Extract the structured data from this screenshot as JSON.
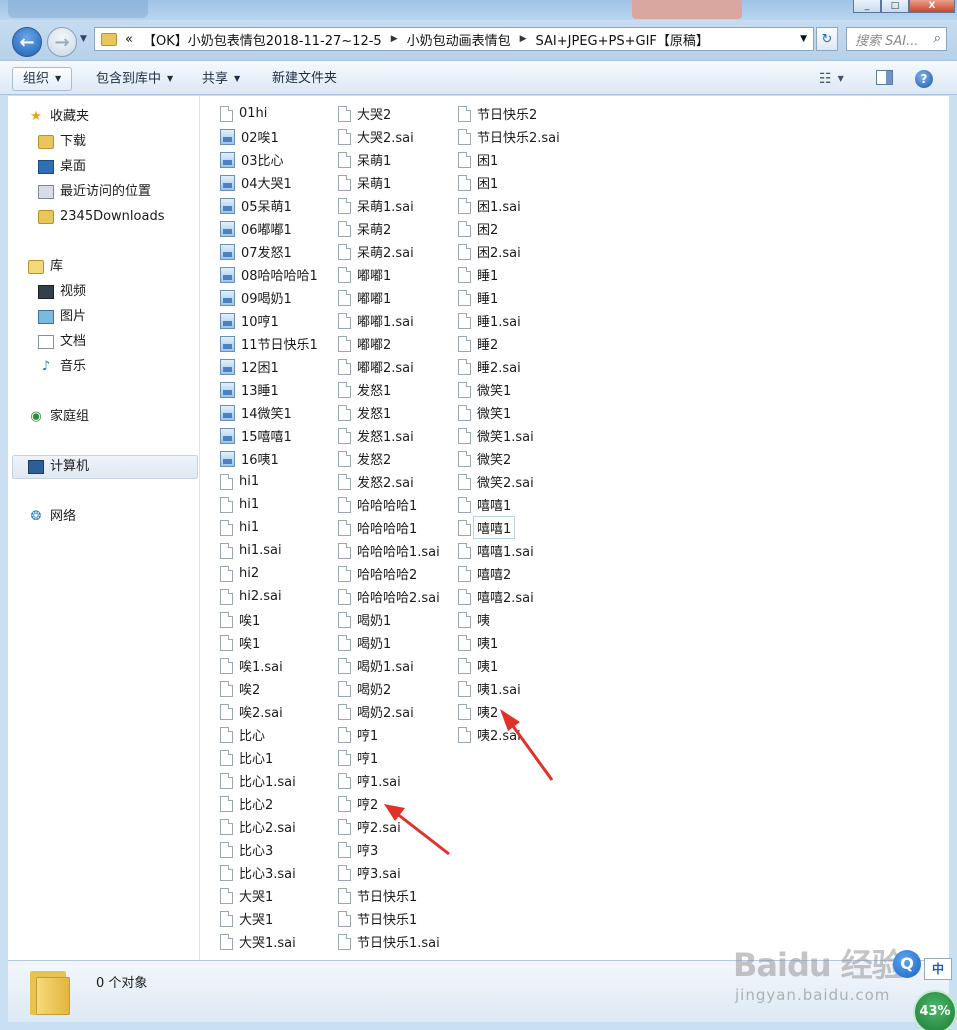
{
  "window": {
    "close_label": "X",
    "min_label": "_",
    "max_label": "□"
  },
  "address": {
    "overflow": "«",
    "segments": [
      "【OK】小奶包表情包2018-11-27~12-5",
      "小奶包动画表情包",
      "SAI+JPEG+PS+GIF【原稿】"
    ],
    "search_placeholder": "搜索 SAI..."
  },
  "toolbar": {
    "organize": "组织",
    "include_in_library": "包含到库中",
    "share": "共享",
    "new_folder": "新建文件夹"
  },
  "nav": {
    "favorites": "收藏夹",
    "downloads": "下载",
    "desktop": "桌面",
    "recent": "最近访问的位置",
    "downloads2345": "2345Downloads",
    "libraries": "库",
    "videos": "视频",
    "pictures": "图片",
    "documents": "文档",
    "music": "音乐",
    "homegroup": "家庭组",
    "computer": "计算机",
    "network": "网络"
  },
  "files": {
    "col1": [
      {
        "name": "01hi",
        "type": "file"
      },
      {
        "name": "02唉1",
        "type": "image"
      },
      {
        "name": "03比心",
        "type": "image"
      },
      {
        "name": "04大哭1",
        "type": "image"
      },
      {
        "name": "05呆萌1",
        "type": "image"
      },
      {
        "name": "06嘟嘟1",
        "type": "image"
      },
      {
        "name": "07发怒1",
        "type": "image"
      },
      {
        "name": "08哈哈哈哈1",
        "type": "image"
      },
      {
        "name": "09喝奶1",
        "type": "image"
      },
      {
        "name": "10哼1",
        "type": "image"
      },
      {
        "name": "11节日快乐1",
        "type": "image"
      },
      {
        "name": "12困1",
        "type": "image"
      },
      {
        "name": "13睡1",
        "type": "image"
      },
      {
        "name": "14微笑1",
        "type": "image"
      },
      {
        "name": "15嘻嘻1",
        "type": "image"
      },
      {
        "name": "16咦1",
        "type": "image"
      },
      {
        "name": "hi1",
        "type": "file"
      },
      {
        "name": "hi1",
        "type": "file"
      },
      {
        "name": "hi1",
        "type": "file"
      },
      {
        "name": "hi1.sai",
        "type": "file"
      },
      {
        "name": "hi2",
        "type": "file"
      },
      {
        "name": "hi2.sai",
        "type": "file"
      },
      {
        "name": "唉1",
        "type": "file"
      },
      {
        "name": "唉1",
        "type": "file"
      },
      {
        "name": "唉1.sai",
        "type": "file"
      },
      {
        "name": "唉2",
        "type": "file"
      },
      {
        "name": "唉2.sai",
        "type": "file"
      },
      {
        "name": "比心",
        "type": "file"
      },
      {
        "name": "比心1",
        "type": "file"
      },
      {
        "name": "比心1.sai",
        "type": "file"
      },
      {
        "name": "比心2",
        "type": "file"
      },
      {
        "name": "比心2.sai",
        "type": "file"
      },
      {
        "name": "比心3",
        "type": "file"
      },
      {
        "name": "比心3.sai",
        "type": "file"
      },
      {
        "name": "大哭1",
        "type": "file"
      },
      {
        "name": "大哭1",
        "type": "file"
      },
      {
        "name": "大哭1.sai",
        "type": "file"
      }
    ],
    "col2": [
      {
        "name": "大哭2",
        "type": "file"
      },
      {
        "name": "大哭2.sai",
        "type": "file"
      },
      {
        "name": "呆萌1",
        "type": "file"
      },
      {
        "name": "呆萌1",
        "type": "file"
      },
      {
        "name": "呆萌1.sai",
        "type": "file"
      },
      {
        "name": "呆萌2",
        "type": "file"
      },
      {
        "name": "呆萌2.sai",
        "type": "file"
      },
      {
        "name": "嘟嘟1",
        "type": "file"
      },
      {
        "name": "嘟嘟1",
        "type": "file"
      },
      {
        "name": "嘟嘟1.sai",
        "type": "file"
      },
      {
        "name": "嘟嘟2",
        "type": "file"
      },
      {
        "name": "嘟嘟2.sai",
        "type": "file"
      },
      {
        "name": "发怒1",
        "type": "file"
      },
      {
        "name": "发怒1",
        "type": "file"
      },
      {
        "name": "发怒1.sai",
        "type": "file"
      },
      {
        "name": "发怒2",
        "type": "file"
      },
      {
        "name": "发怒2.sai",
        "type": "file"
      },
      {
        "name": "哈哈哈哈1",
        "type": "file"
      },
      {
        "name": "哈哈哈哈1",
        "type": "file"
      },
      {
        "name": "哈哈哈哈1.sai",
        "type": "file"
      },
      {
        "name": "哈哈哈哈2",
        "type": "file"
      },
      {
        "name": "哈哈哈哈2.sai",
        "type": "file"
      },
      {
        "name": "喝奶1",
        "type": "file"
      },
      {
        "name": "喝奶1",
        "type": "file"
      },
      {
        "name": "喝奶1.sai",
        "type": "file"
      },
      {
        "name": "喝奶2",
        "type": "file"
      },
      {
        "name": "喝奶2.sai",
        "type": "file"
      },
      {
        "name": "哼1",
        "type": "file"
      },
      {
        "name": "哼1",
        "type": "file"
      },
      {
        "name": "哼1.sai",
        "type": "file"
      },
      {
        "name": "哼2",
        "type": "file"
      },
      {
        "name": "哼2.sai",
        "type": "file"
      },
      {
        "name": "哼3",
        "type": "file"
      },
      {
        "name": "哼3.sai",
        "type": "file"
      },
      {
        "name": "节日快乐1",
        "type": "file"
      },
      {
        "name": "节日快乐1",
        "type": "file"
      },
      {
        "name": "节日快乐1.sai",
        "type": "file"
      }
    ],
    "col3": [
      {
        "name": "节日快乐2",
        "type": "file"
      },
      {
        "name": "节日快乐2.sai",
        "type": "file"
      },
      {
        "name": "困1",
        "type": "file"
      },
      {
        "name": "困1",
        "type": "file"
      },
      {
        "name": "困1.sai",
        "type": "file"
      },
      {
        "name": "困2",
        "type": "file"
      },
      {
        "name": "困2.sai",
        "type": "file"
      },
      {
        "name": "睡1",
        "type": "file"
      },
      {
        "name": "睡1",
        "type": "file"
      },
      {
        "name": "睡1.sai",
        "type": "file"
      },
      {
        "name": "睡2",
        "type": "file"
      },
      {
        "name": "睡2.sai",
        "type": "file"
      },
      {
        "name": "微笑1",
        "type": "file"
      },
      {
        "name": "微笑1",
        "type": "file"
      },
      {
        "name": "微笑1.sai",
        "type": "file"
      },
      {
        "name": "微笑2",
        "type": "file"
      },
      {
        "name": "微笑2.sai",
        "type": "file"
      },
      {
        "name": "嘻嘻1",
        "type": "file"
      },
      {
        "name": "嘻嘻1",
        "type": "file",
        "focused": true
      },
      {
        "name": "嘻嘻1.sai",
        "type": "file"
      },
      {
        "name": "嘻嘻2",
        "type": "file"
      },
      {
        "name": "嘻嘻2.sai",
        "type": "file"
      },
      {
        "name": "咦",
        "type": "file"
      },
      {
        "name": "咦1",
        "type": "file"
      },
      {
        "name": "咦1",
        "type": "file"
      },
      {
        "name": "咦1.sai",
        "type": "file"
      },
      {
        "name": "咦2",
        "type": "file"
      },
      {
        "name": "咦2.sai",
        "type": "file"
      }
    ]
  },
  "details": {
    "count_text": "0 个对象"
  },
  "overlay": {
    "watermark": "Baidu 经验",
    "watermark_sub": "jingyan.baidu.com",
    "tray_q": "Q",
    "tray_ime": "中",
    "tray_percent": "43%"
  },
  "colors": {
    "frame": "#c9dff2",
    "accent": "#2f6fb3",
    "annotation_arrow": "#e0322b"
  }
}
